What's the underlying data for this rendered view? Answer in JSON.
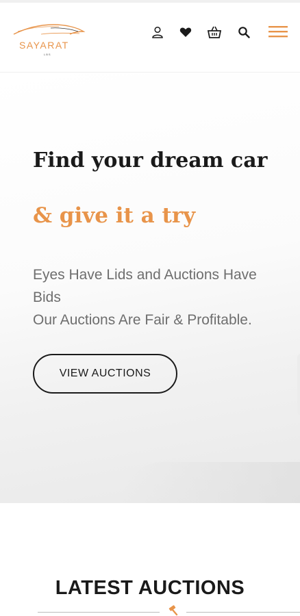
{
  "brand": {
    "name": "SAYARAT",
    "tagline": "LBS",
    "accent_color": "#e8944a"
  },
  "header": {
    "icons": [
      "user-icon",
      "heart-icon",
      "basket-icon",
      "search-icon",
      "menu-icon"
    ]
  },
  "hero": {
    "title": "Find your dream car",
    "subtitle": "& give it a try",
    "text_lines": [
      "Eyes Have Lids and Auctions Have",
      "Bids",
      "Our Auctions Are Fair & Profitable."
    ],
    "button_label": "VIEW AUCTIONS"
  },
  "latest": {
    "title": "LATEST AUCTIONS",
    "divider_icon": "gavel-icon"
  },
  "colors": {
    "text": "#1a1a1a",
    "muted": "#6e6e6e",
    "accent": "#e8944a"
  }
}
